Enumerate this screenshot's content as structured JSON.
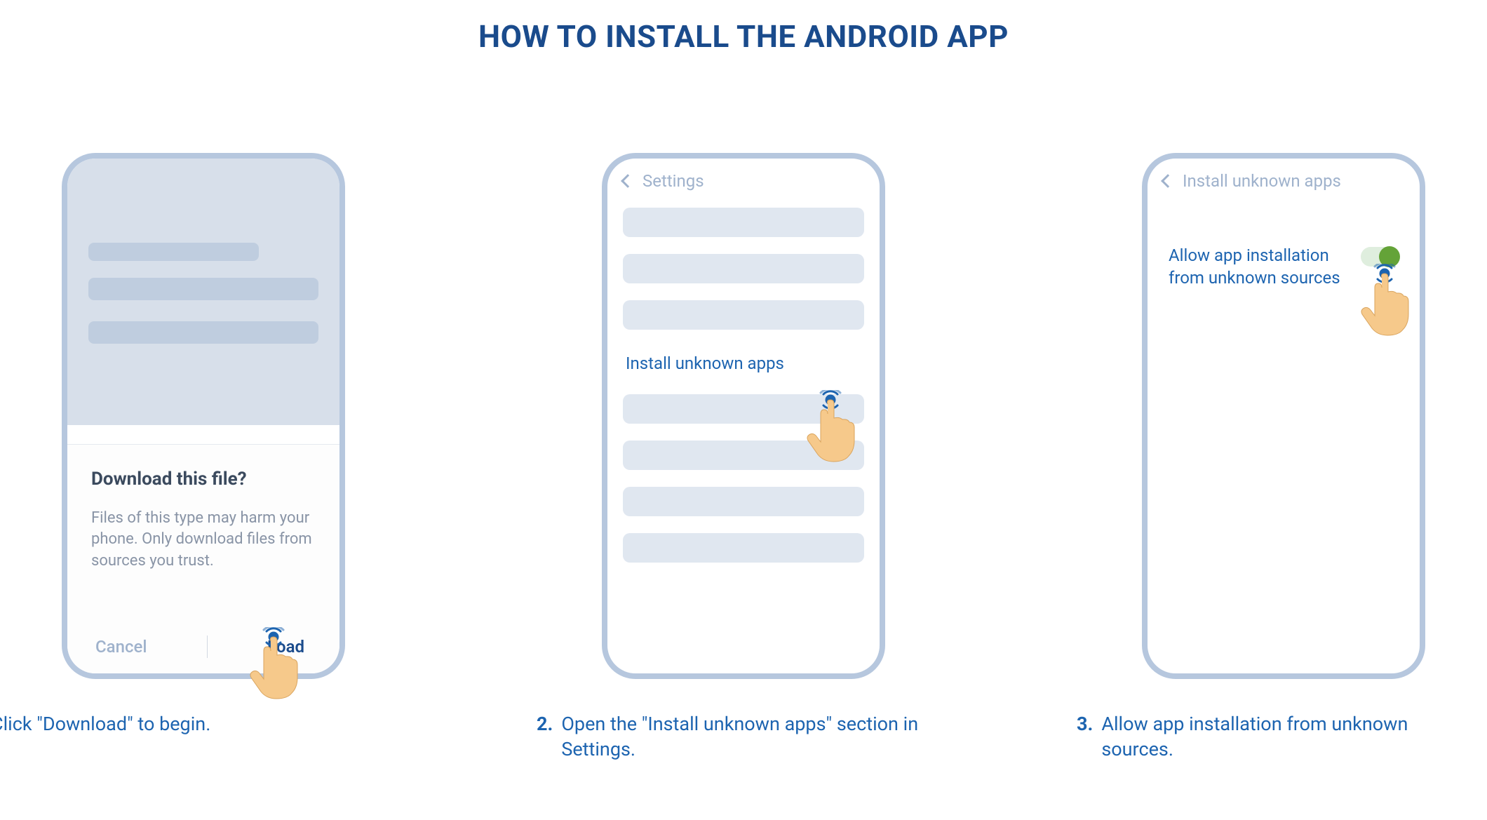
{
  "title": "HOW TO INSTALL THE ANDROID APP",
  "steps": [
    {
      "phone": {
        "dialog": {
          "title": "Download this file?",
          "body": "Files of this type may harm your phone. Only download files from sources you trust.",
          "cancel": "Cancel",
          "confirm": "Load"
        }
      },
      "caption_number": "",
      "caption_text": "Click \"Download\" to begin."
    },
    {
      "phone": {
        "header": "Settings",
        "link": "Install unknown apps"
      },
      "caption_number": "2.",
      "caption_text": "Open the \"Install unknown apps\" section in Settings."
    },
    {
      "phone": {
        "header": "Install unknown apps",
        "toggle_label": "Allow app installation from unknown sources"
      },
      "caption_number": "3.",
      "caption_text": "Allow app installation from unknown sources."
    }
  ]
}
